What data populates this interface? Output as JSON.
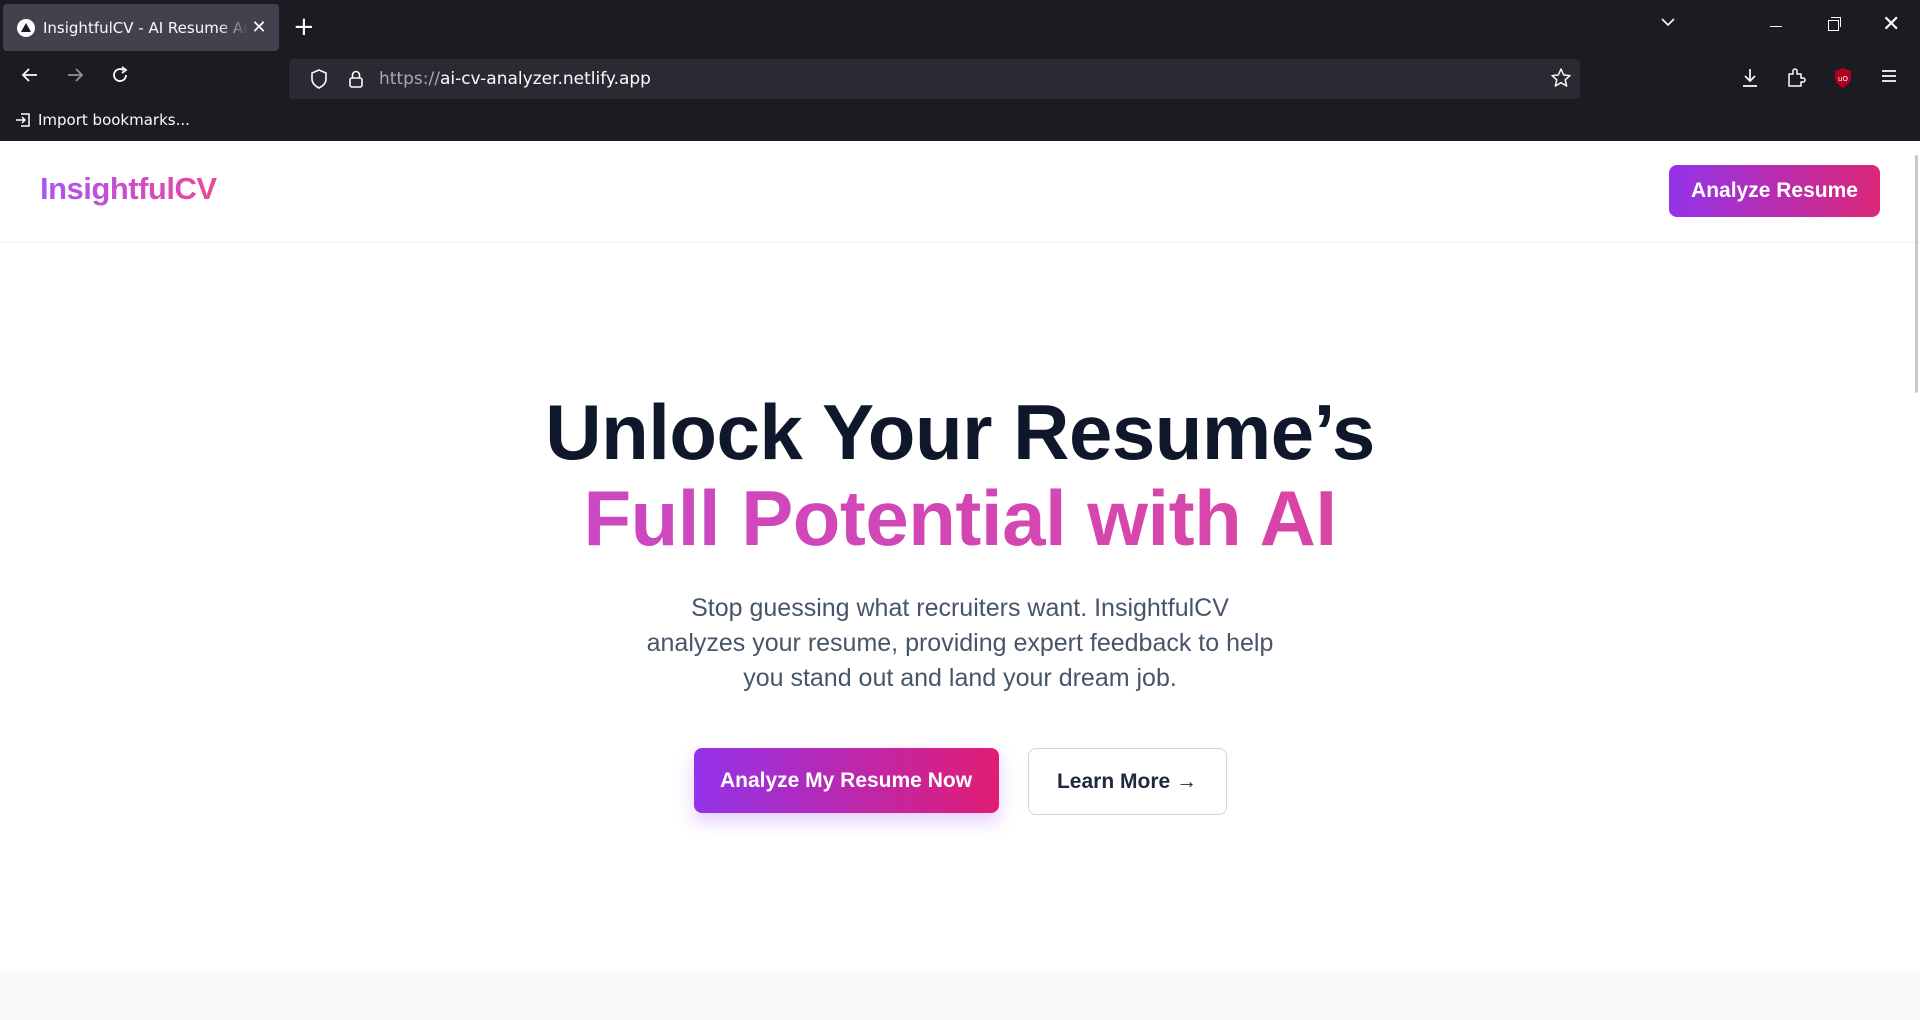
{
  "browser": {
    "tab_title": "InsightfulCV - AI Resume Analyzer",
    "url_scheme": "https://",
    "url_host": "ai-cv-analyzer.netlify.app",
    "bookmark_label": "Import bookmarks...",
    "icons": [
      "close-icon",
      "plus-icon",
      "chevron-down-icon",
      "minimize-icon",
      "restore-icon",
      "back-arrow-icon",
      "forward-arrow-icon",
      "reload-icon",
      "shield-icon",
      "lock-icon",
      "star-icon",
      "download-icon",
      "extensions-icon",
      "ublock-icon",
      "menu-icon",
      "import-icon"
    ]
  },
  "site": {
    "logo": "InsightfulCV",
    "header_cta": "Analyze Resume"
  },
  "hero": {
    "title_line1": "Unlock Your Resume’s",
    "title_line2": "Full Potential with AI",
    "subtitle": "Stop guessing what recruiters want. InsightfulCV analyzes your resume, providing expert feedback to help you stand out and land your dream job.",
    "primary_cta": "Analyze My Resume Now",
    "secondary_cta": "Learn More →"
  },
  "colors": {
    "brand_gradient_start": "#9333ea",
    "brand_gradient_end": "#db2777",
    "heading": "#0f172a",
    "body_text": "#475569",
    "chrome_bg": "#1c1b22"
  }
}
